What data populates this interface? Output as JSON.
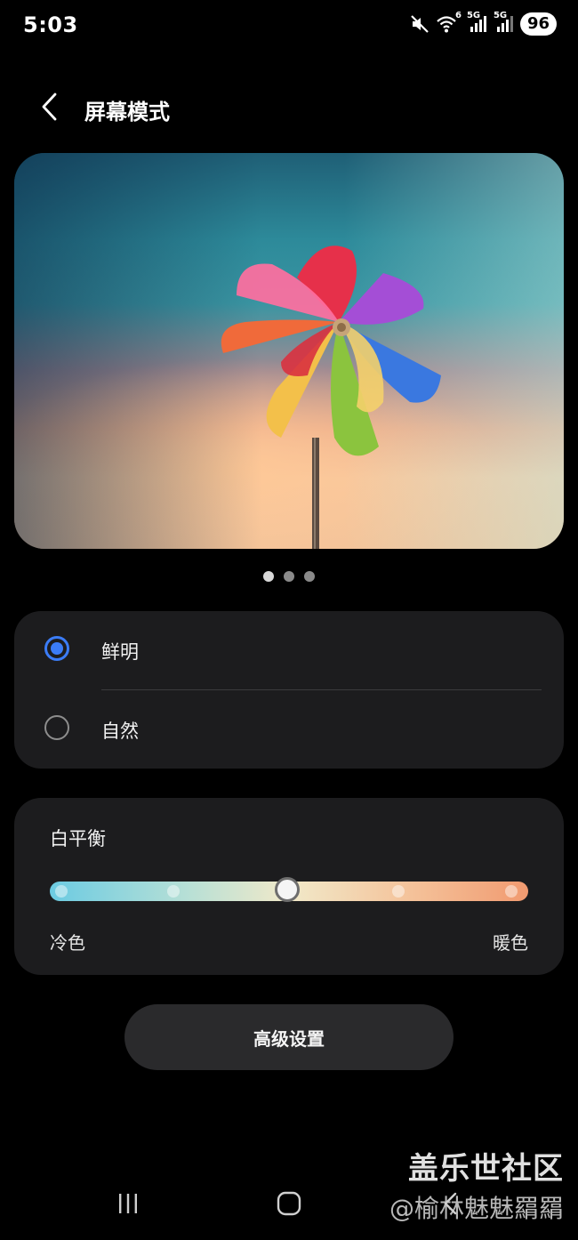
{
  "status_bar": {
    "time": "5:03",
    "battery": "96",
    "signal_1_label": "5G",
    "signal_2_label": "5G",
    "wifi_label": "6"
  },
  "header": {
    "title": "屏幕模式"
  },
  "carousel": {
    "count": 3,
    "active_index": 0
  },
  "mode": {
    "options": [
      {
        "label": "鲜明",
        "selected": true
      },
      {
        "label": "自然",
        "selected": false
      }
    ]
  },
  "white_balance": {
    "title": "白平衡",
    "left_label": "冷色",
    "right_label": "暖色",
    "steps": 5,
    "value_step": 2
  },
  "advanced_button": {
    "label": "高级设置"
  },
  "watermark": {
    "brand": "盖乐世社区",
    "user": "@榆林魅魅羂羂"
  },
  "colors": {
    "accent": "#3b7cf6",
    "background": "#000000",
    "card": "#1c1c1e"
  }
}
